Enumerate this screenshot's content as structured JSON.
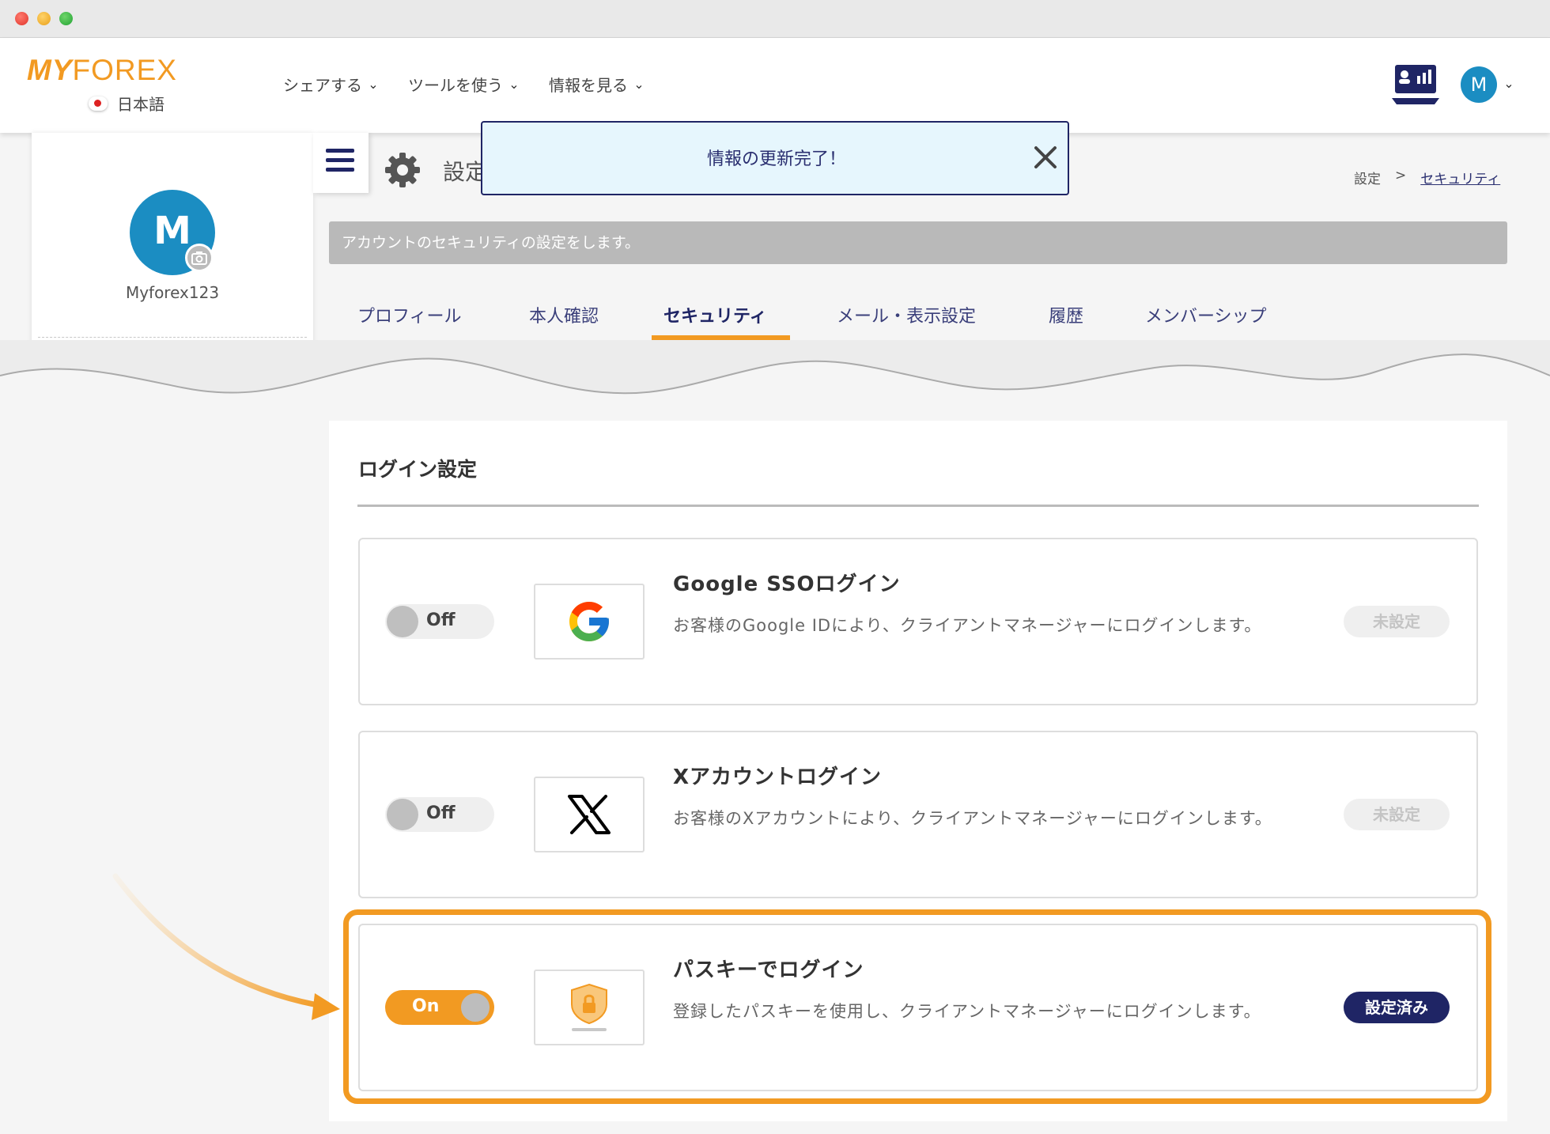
{
  "header": {
    "logo": {
      "part1": "MY",
      "part2": "FOREX"
    },
    "language": "日本語",
    "nav": [
      {
        "label": "シェアする"
      },
      {
        "label": "ツールを使う"
      },
      {
        "label": "情報を見る"
      }
    ],
    "avatar_initial": "M"
  },
  "sidebar": {
    "avatar_initial": "M",
    "username": "Myforex123"
  },
  "page": {
    "title": "設定",
    "breadcrumb": {
      "root": "設定",
      "sep": ">",
      "current": "セキュリティ"
    },
    "info": "アカウントのセキュリティの設定をします。"
  },
  "toast": {
    "message": "情報の更新完了！"
  },
  "tabs": [
    {
      "label": "プロフィール"
    },
    {
      "label": "本人確認"
    },
    {
      "label": "セキュリティ"
    },
    {
      "label": "メール・表示設定"
    },
    {
      "label": "履歴"
    },
    {
      "label": "メンバーシップ"
    }
  ],
  "active_tab": "セキュリティ",
  "login_settings": {
    "title": "ログイン設定",
    "items": [
      {
        "title": "Google SSOログイン",
        "desc": "お客様のGoogle IDにより、クライアントマネージャーにログインします。",
        "toggle": "Off",
        "status": "未設定",
        "icon": "google-icon"
      },
      {
        "title": "Xアカウントログイン",
        "desc": "お客様のXアカウントにより、クライアントマネージャーにログインします。",
        "toggle": "Off",
        "status": "未設定",
        "icon": "x-icon"
      },
      {
        "title": "パスキーでログイン",
        "desc": "登録したパスキーを使用し、クライアントマネージャーにログインします。",
        "toggle": "On",
        "status": "設定済み",
        "icon": "passkey-shield-icon"
      }
    ]
  },
  "colors": {
    "accent": "#f29a22",
    "navy": "#1f2565",
    "avatar": "#1b8dc2"
  }
}
